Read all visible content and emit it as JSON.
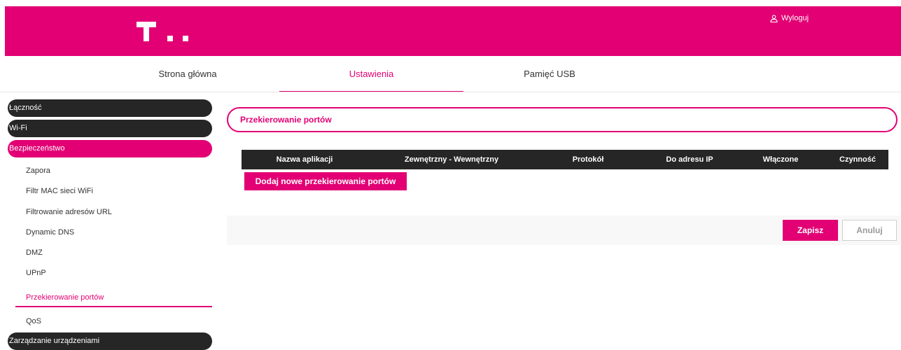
{
  "header": {
    "logout_label": "Wyloguj"
  },
  "nav": {
    "tabs": [
      {
        "label": "Strona główna"
      },
      {
        "label": "Ustawienia"
      },
      {
        "label": "Pamięć USB"
      }
    ],
    "active_tab": "Ustawienia"
  },
  "sidebar": {
    "sections": [
      {
        "label": "Łączność"
      },
      {
        "label": "Wi-Fi"
      },
      {
        "label": "Bezpieczeństwo"
      },
      {
        "label": "Zarządzanie urządzeniami"
      }
    ],
    "sub_items": [
      {
        "label": "Zapora"
      },
      {
        "label": "Filtr MAC sieci WiFi"
      },
      {
        "label": "Filtrowanie adresów URL"
      },
      {
        "label": "Dynamic DNS"
      },
      {
        "label": "DMZ"
      },
      {
        "label": "UPnP"
      },
      {
        "label": "Przekierowanie portów"
      },
      {
        "label": "QoS"
      }
    ],
    "active_section": "Bezpieczeństwo",
    "active_sub_item": "Przekierowanie portów"
  },
  "main": {
    "title": "Przekierowanie portów",
    "table": {
      "columns": [
        "Nazwa aplikacji",
        "Zewnętrzny - Wewnętrzny",
        "Protokół",
        "Do adresu IP",
        "Włączone",
        "Czynność"
      ],
      "rows": []
    },
    "add_button_label": "Dodaj nowe przekierowanie portów",
    "save_label": "Zapisz",
    "cancel_label": "Anuluj"
  },
  "colors": {
    "brand": "#e20074",
    "dark": "#262626"
  }
}
